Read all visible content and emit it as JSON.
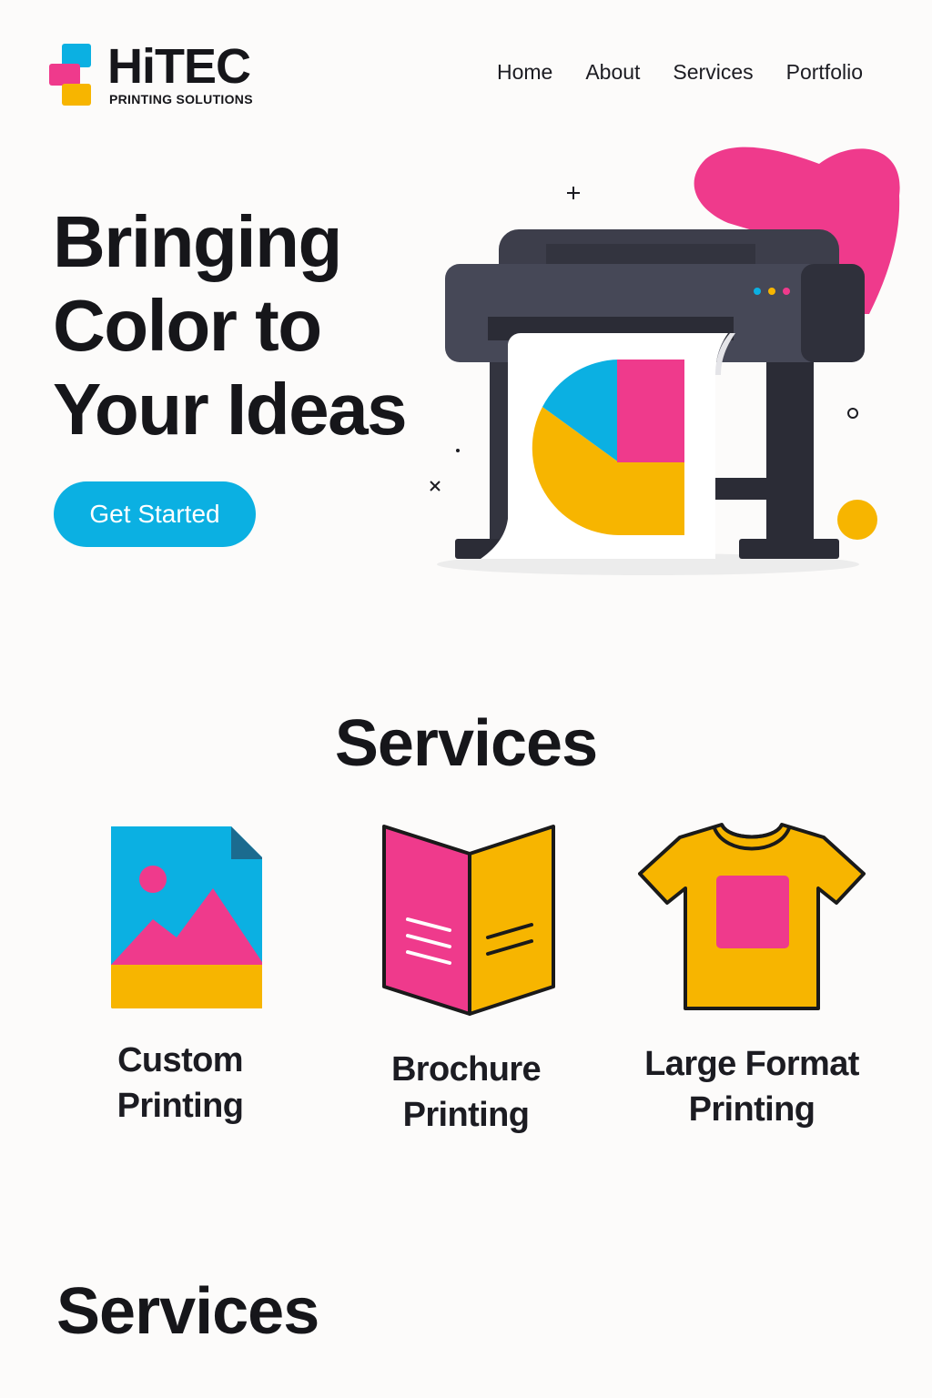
{
  "brand": {
    "name": "HiTEC",
    "tagline": "PRINTING SOLUTIONS",
    "colors": {
      "cyan": "#0bb0e2",
      "magenta": "#ef3a8c",
      "yellow": "#f7b500",
      "dark": "#16161a"
    }
  },
  "nav": {
    "items": [
      {
        "label": "Home"
      },
      {
        "label": "About"
      },
      {
        "label": "Services"
      },
      {
        "label": "Portfolio"
      }
    ]
  },
  "hero": {
    "title_lines": [
      "Bringing",
      "Color to",
      "Your Ideas"
    ],
    "cta_label": "Get Started",
    "illustration": "wide-format-printer-icon"
  },
  "services": {
    "title": "Services",
    "items": [
      {
        "label_lines": [
          "Custom",
          "Printing"
        ],
        "icon": "image-file-icon"
      },
      {
        "label_lines": [
          "Brochure",
          "Printing"
        ],
        "icon": "brochure-icon"
      },
      {
        "label_lines": [
          "Large Format",
          "Printing"
        ],
        "icon": "tshirt-icon"
      }
    ]
  },
  "section2": {
    "title": "Services"
  }
}
